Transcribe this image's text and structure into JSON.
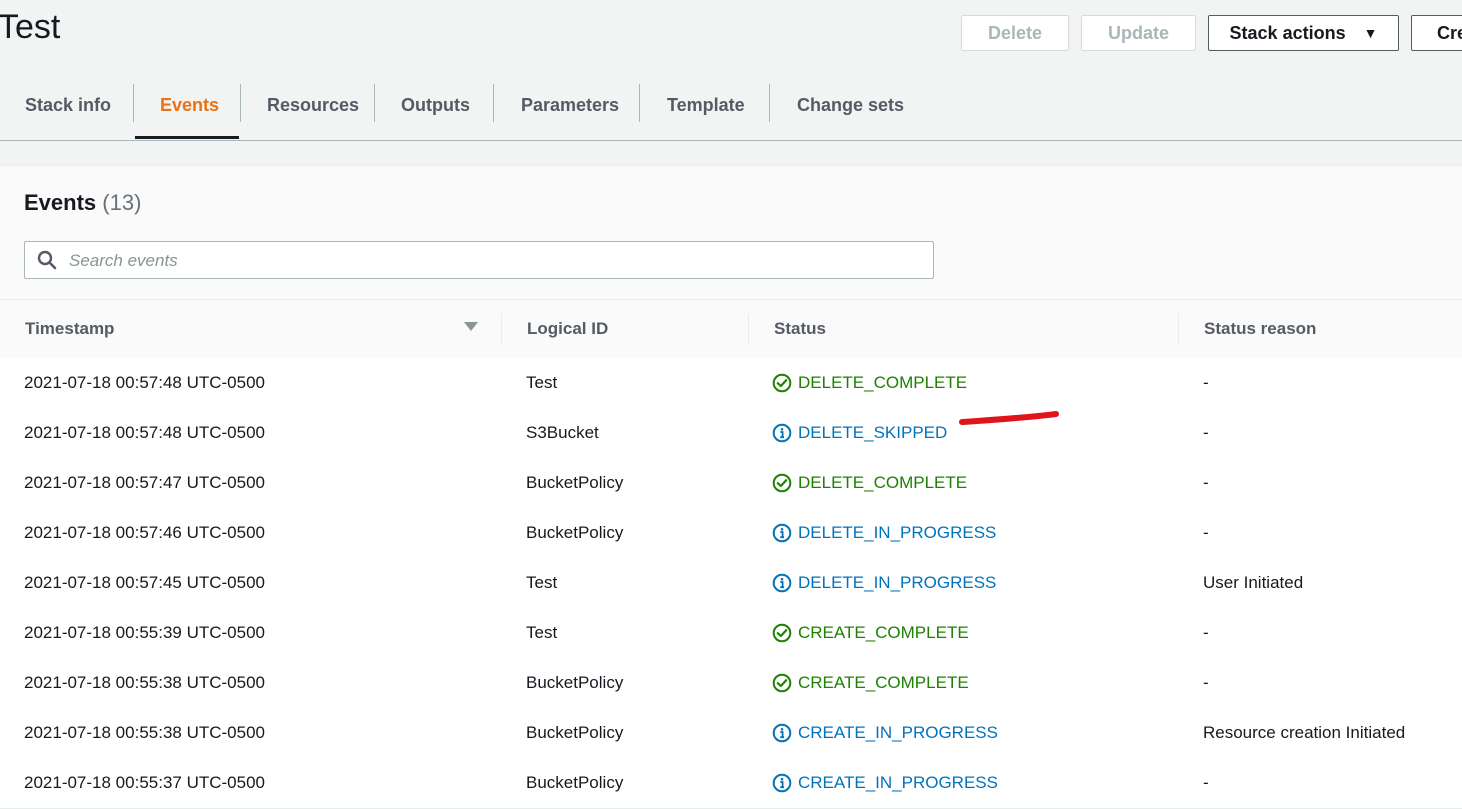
{
  "stack": {
    "title": "Test"
  },
  "actions": {
    "delete": "Delete",
    "update": "Update",
    "stack_actions": "Stack actions",
    "create": "Cre"
  },
  "tabs": [
    {
      "label": "Stack info"
    },
    {
      "label": "Events"
    },
    {
      "label": "Resources"
    },
    {
      "label": "Outputs"
    },
    {
      "label": "Parameters"
    },
    {
      "label": "Template"
    },
    {
      "label": "Change sets"
    }
  ],
  "active_tab": "Events",
  "events": {
    "title": "Events",
    "count": "(13)",
    "search_placeholder": "Search events",
    "columns": [
      "Timestamp",
      "Logical ID",
      "Status",
      "Status reason"
    ],
    "rows": [
      {
        "timestamp": "2021-07-18 00:57:48 UTC-0500",
        "logical_id": "Test",
        "status": "DELETE_COMPLETE",
        "status_type": "success",
        "reason": "-"
      },
      {
        "timestamp": "2021-07-18 00:57:48 UTC-0500",
        "logical_id": "S3Bucket",
        "status": "DELETE_SKIPPED",
        "status_type": "info",
        "reason": "-"
      },
      {
        "timestamp": "2021-07-18 00:57:47 UTC-0500",
        "logical_id": "BucketPolicy",
        "status": "DELETE_COMPLETE",
        "status_type": "success",
        "reason": "-"
      },
      {
        "timestamp": "2021-07-18 00:57:46 UTC-0500",
        "logical_id": "BucketPolicy",
        "status": "DELETE_IN_PROGRESS",
        "status_type": "info",
        "reason": "-"
      },
      {
        "timestamp": "2021-07-18 00:57:45 UTC-0500",
        "logical_id": "Test",
        "status": "DELETE_IN_PROGRESS",
        "status_type": "info",
        "reason": "User Initiated"
      },
      {
        "timestamp": "2021-07-18 00:55:39 UTC-0500",
        "logical_id": "Test",
        "status": "CREATE_COMPLETE",
        "status_type": "success",
        "reason": "-"
      },
      {
        "timestamp": "2021-07-18 00:55:38 UTC-0500",
        "logical_id": "BucketPolicy",
        "status": "CREATE_COMPLETE",
        "status_type": "success",
        "reason": "-"
      },
      {
        "timestamp": "2021-07-18 00:55:38 UTC-0500",
        "logical_id": "BucketPolicy",
        "status": "CREATE_IN_PROGRESS",
        "status_type": "info",
        "reason": "Resource creation Initiated"
      },
      {
        "timestamp": "2021-07-18 00:55:37 UTC-0500",
        "logical_id": "BucketPolicy",
        "status": "CREATE_IN_PROGRESS",
        "status_type": "info",
        "reason": "-"
      }
    ]
  },
  "colors": {
    "accent": "#ec7211",
    "success": "#1d8102",
    "info": "#0073bb",
    "annotation": "#e0151b"
  }
}
